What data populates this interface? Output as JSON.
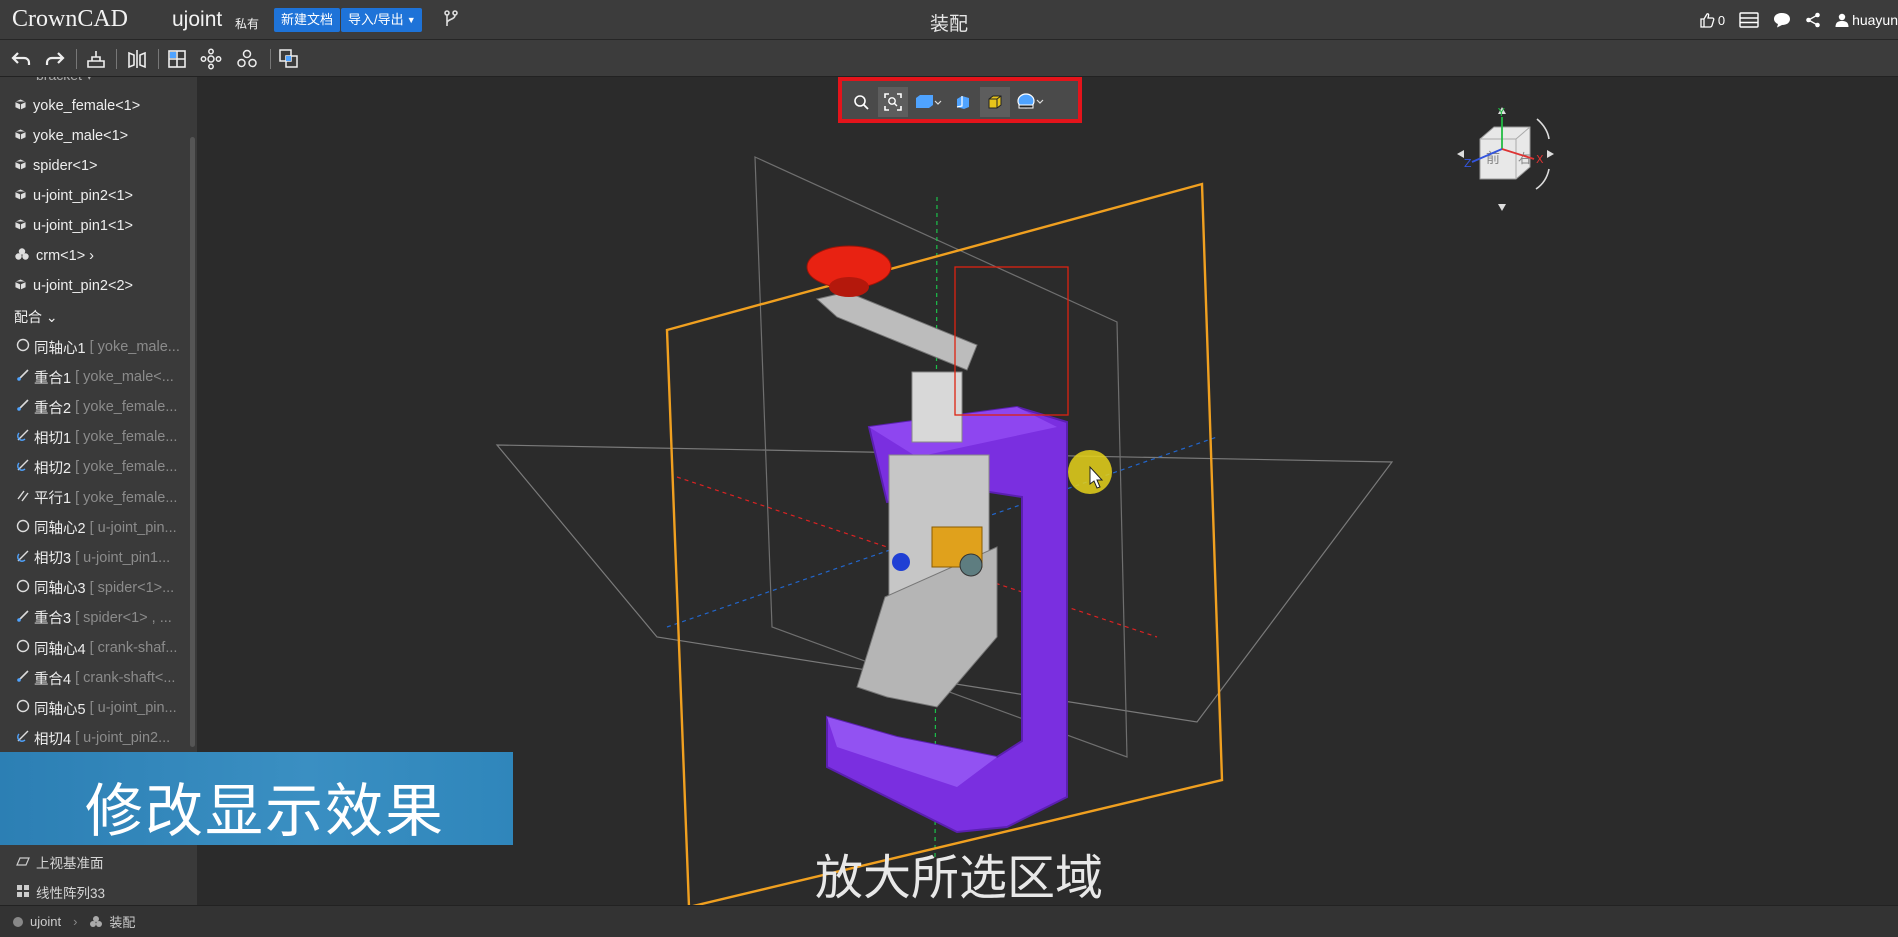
{
  "header": {
    "logo": "CrownCAD",
    "doc_name": "ujoint",
    "private_tag": "私有",
    "new_doc_btn": "新建文档",
    "import_export_btn": "导入/导出",
    "title": "装配",
    "likes_count": "0",
    "username": "huayun"
  },
  "sidebar": {
    "parts": [
      {
        "label": "yoke_female<1>",
        "icon": "part-icon"
      },
      {
        "label": "yoke_male<1>",
        "icon": "part-icon"
      },
      {
        "label": "spider<1>",
        "icon": "part-icon"
      },
      {
        "label": "u-joint_pin2<1>",
        "icon": "part-icon"
      },
      {
        "label": "u-joint_pin1<1>",
        "icon": "part-icon"
      },
      {
        "label": "crm<1> ›",
        "icon": "subassembly-icon"
      },
      {
        "label": "u-joint_pin2<2>",
        "icon": "part-icon"
      }
    ],
    "mates_section": "配合 ⌄",
    "mates": [
      {
        "name": "同轴心1",
        "ref": "[ yoke_male...",
        "icon": "concentric-icon"
      },
      {
        "name": "重合1",
        "ref": "[ yoke_male<...",
        "icon": "coincident-icon"
      },
      {
        "name": "重合2",
        "ref": "[ yoke_female...",
        "icon": "coincident-icon"
      },
      {
        "name": "相切1",
        "ref": "[ yoke_female...",
        "icon": "tangent-icon"
      },
      {
        "name": "相切2",
        "ref": "[ yoke_female...",
        "icon": "tangent-icon"
      },
      {
        "name": "平行1",
        "ref": "[ yoke_female...",
        "icon": "parallel-icon"
      },
      {
        "name": "同轴心2",
        "ref": "[ u-joint_pin...",
        "icon": "concentric-icon"
      },
      {
        "name": "相切3",
        "ref": "[ u-joint_pin1...",
        "icon": "tangent-icon"
      },
      {
        "name": "同轴心3",
        "ref": "[ spider<1>...",
        "icon": "concentric-icon"
      },
      {
        "name": "重合3",
        "ref": "[ spider<1> , ...",
        "icon": "coincident-icon"
      },
      {
        "name": "同轴心4",
        "ref": "[ crank-shaf...",
        "icon": "concentric-icon"
      },
      {
        "name": "重合4",
        "ref": "[ crank-shaft<...",
        "icon": "coincident-icon"
      },
      {
        "name": "同轴心5",
        "ref": "[ u-joint_pin...",
        "icon": "concentric-icon"
      },
      {
        "name": "相切4",
        "ref": "[ u-joint_pin2...",
        "icon": "tangent-icon"
      }
    ],
    "lower": [
      {
        "label": "上视基准面",
        "icon": "plane-icon"
      },
      {
        "label": "线性阵列33",
        "icon": "linear-pattern-icon"
      }
    ]
  },
  "overlay": {
    "banner": "修改显示效果",
    "subtitle": "放大所选区域"
  },
  "viewcube": {
    "front_label": "前",
    "right_label": "右",
    "axis_y": "Y",
    "axis_z": "Z",
    "axis_x": "X"
  },
  "statusbar": {
    "doc": "ujoint",
    "assembly": "装配"
  },
  "colors": {
    "highlight_border": "#e4141b",
    "primary_button": "#1e73d8",
    "banner": "#2f86bb",
    "part_purple": "#7a2fe0",
    "knob_red": "#e82212",
    "plane_orange": "#f0a020"
  }
}
